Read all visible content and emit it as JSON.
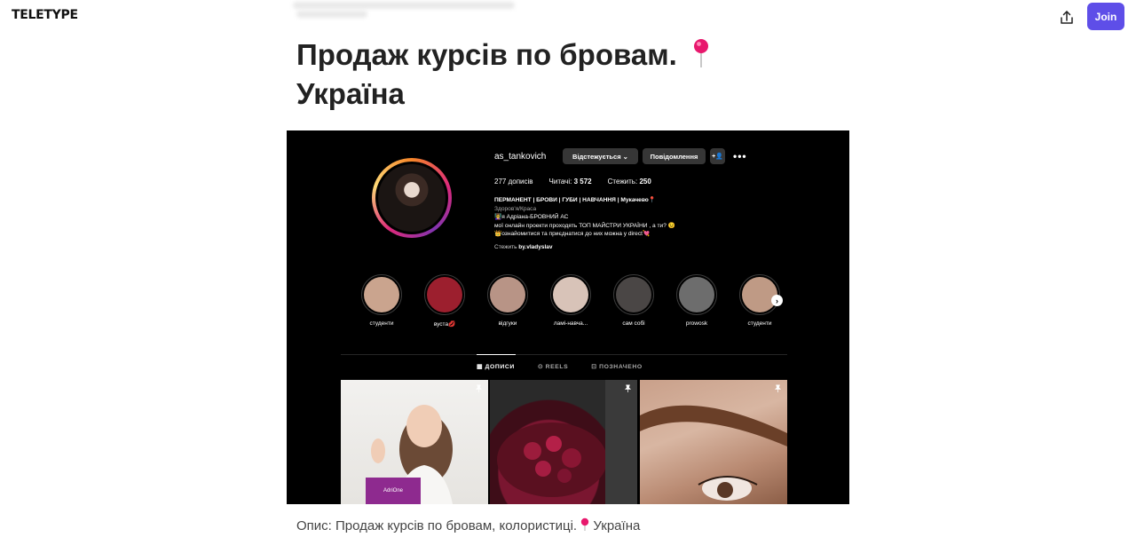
{
  "header": {
    "logo": "TELETYPE",
    "join_label": "Join"
  },
  "article": {
    "title_line1": "Продаж курсів по бровам.",
    "title_line2": "Україна",
    "caption_prefix": "Опис: Продаж курсів по бровам, колористиці.",
    "caption_suffix": "Україна"
  },
  "instagram": {
    "username": "as_tankovich",
    "follow_label": "Відстежується ⌄",
    "message_label": "Повідомлення",
    "posts_count": "277 дописів",
    "followers_label": "Читачі:",
    "followers_value": "3 572",
    "following_label": "Стежить:",
    "following_value": "250",
    "bio_title": "ПЕРМАНЕНТ | БРОВИ | ГУБИ | НАВЧАННЯ | Мукачево📍",
    "bio_category": "Здоров'я/Краса",
    "bio_line1": "👩‍🏫я Адріана-БРОВНИЙ АС",
    "bio_line2": "мої онлайн проекти проходять ТОП МАЙСТРИ УКРАЇНИ , а ти? 😉",
    "bio_line3": "👑ознайомитися та приєднатися до них можна у direct💘",
    "followed_by_prefix": "Стежить",
    "followed_by_name": "by.vladyslav",
    "highlights": [
      {
        "label": "студенти",
        "color": "#caa48e"
      },
      {
        "label": "вуста💋",
        "color": "#9c1f2e"
      },
      {
        "label": "відгуки",
        "color": "#b89486"
      },
      {
        "label": "ламі-навча...",
        "color": "#d8c3b8"
      },
      {
        "label": "сам собі",
        "color": "#4a4645"
      },
      {
        "label": "prowosk",
        "color": "#6d6d6d"
      },
      {
        "label": "студенти",
        "color": "#bf9a85"
      }
    ],
    "tabs": {
      "posts": "ДОПИСИ",
      "reels": "REELS",
      "tagged": "ПОЗНАЧЕНО"
    },
    "post_bag_text": "AdriOne"
  }
}
